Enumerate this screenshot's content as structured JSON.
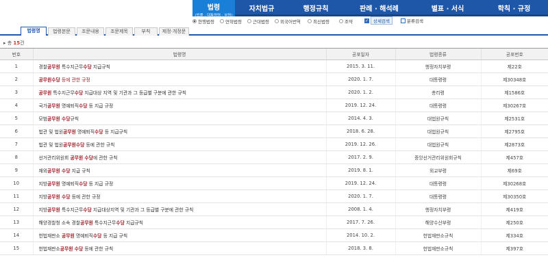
{
  "nav": {
    "items": [
      {
        "label": "법령",
        "sub": "(법률 · 대통령령 · 부령)",
        "active": true
      },
      {
        "label": "자치법규"
      },
      {
        "label": "행정규칙"
      },
      {
        "label": "판례 · 해석례"
      },
      {
        "label": "별표 · 서식"
      },
      {
        "label": "학칙 · 규정"
      }
    ]
  },
  "filters": {
    "radios": [
      "현행법령",
      "연혁법령",
      "근대법령",
      "외국어번역",
      "최신법령",
      "조약"
    ],
    "selected": "현행법령",
    "detail_search": "상세검색",
    "category_search": "분류검색"
  },
  "tabs": [
    "법령명",
    "법령본문",
    "조문내용",
    "조문제목",
    "부칙",
    "제정·개정문"
  ],
  "total": {
    "prefix": "▸ 총 ",
    "count": "15",
    "suffix": "건"
  },
  "table": {
    "headers": [
      "번호",
      "법령명",
      "공포일자",
      "법령종류",
      "공포번호"
    ],
    "rows": [
      {
        "no": "1",
        "name": [
          [
            "경찰",
            ""
          ],
          [
            "공무원",
            "hl"
          ],
          [
            " 특수지근무",
            ""
          ],
          [
            "수당",
            "hl"
          ],
          [
            " 지급규칙",
            ""
          ]
        ],
        "date": "2015. 3. 11.",
        "kind": "행정자치부령",
        "num": "제22호"
      },
      {
        "no": "2",
        "name": [
          [
            "공무원수당",
            "hl"
          ],
          [
            " 등에 관한 규정",
            "hl2"
          ]
        ],
        "date": "2020. 1. 7.",
        "kind": "대통령령",
        "num": "제30348호"
      },
      {
        "no": "3",
        "name": [
          [
            "공무원",
            "hl"
          ],
          [
            " 특수지근무",
            ""
          ],
          [
            "수당",
            "hl"
          ],
          [
            " 지급대상 지역 및 기관과 그 등급별 구분에 관한 규칙",
            ""
          ]
        ],
        "date": "2020. 1. 2.",
        "kind": "총리령",
        "num": "제1586호"
      },
      {
        "no": "4",
        "name": [
          [
            "국가",
            ""
          ],
          [
            "공무원",
            "hl"
          ],
          [
            " 명예퇴직",
            ""
          ],
          [
            "수당",
            "hl"
          ],
          [
            " 등 지급 규정",
            ""
          ]
        ],
        "date": "2019. 12. 24.",
        "kind": "대통령령",
        "num": "제30267호"
      },
      {
        "no": "5",
        "name": [
          [
            "모범",
            ""
          ],
          [
            "공무원",
            "hl"
          ],
          [
            " ",
            ""
          ],
          [
            "수당",
            "hl"
          ],
          [
            "규칙",
            ""
          ]
        ],
        "date": "2014. 4. 3.",
        "kind": "대법원규칙",
        "num": "제2531호"
      },
      {
        "no": "6",
        "name": [
          [
            "법관 및 법원",
            ""
          ],
          [
            "공무원",
            "hl"
          ],
          [
            " 명예퇴직",
            ""
          ],
          [
            "수당",
            "hl"
          ],
          [
            " 등 지급규칙",
            ""
          ]
        ],
        "date": "2018. 6. 28.",
        "kind": "대법원규칙",
        "num": "제2795호"
      },
      {
        "no": "7",
        "name": [
          [
            "법관 및 법원",
            ""
          ],
          [
            "공무원수당",
            "hl"
          ],
          [
            " 등에 관한 규칙",
            ""
          ]
        ],
        "date": "2019. 12. 26.",
        "kind": "대법원규칙",
        "num": "제2873호"
      },
      {
        "no": "8",
        "name": [
          [
            "선거관리위원회 ",
            ""
          ],
          [
            "공무원",
            "hl"
          ],
          [
            " ",
            ""
          ],
          [
            "수당",
            "hl"
          ],
          [
            "에 관한 규칙",
            ""
          ]
        ],
        "date": "2017. 2. 9.",
        "kind": "중앙선거관리위원회규칙",
        "num": "제457호"
      },
      {
        "no": "9",
        "name": [
          [
            "재외",
            ""
          ],
          [
            "공무원",
            "hl"
          ],
          [
            " ",
            ""
          ],
          [
            "수당",
            "hl"
          ],
          [
            " 지급 규칙",
            ""
          ]
        ],
        "date": "2019. 8. 1.",
        "kind": "외교부령",
        "num": "제69호"
      },
      {
        "no": "10",
        "name": [
          [
            "지방",
            ""
          ],
          [
            "공무원",
            "hl"
          ],
          [
            " 명예퇴직",
            ""
          ],
          [
            "수당",
            "hl"
          ],
          [
            " 등 지급 규정",
            ""
          ]
        ],
        "date": "2019. 12. 24.",
        "kind": "대통령령",
        "num": "제30268호"
      },
      {
        "no": "11",
        "name": [
          [
            "지방",
            ""
          ],
          [
            "공무원",
            "hl"
          ],
          [
            " ",
            ""
          ],
          [
            "수당",
            "hl"
          ],
          [
            " 등에 관한 규정",
            ""
          ]
        ],
        "date": "2020. 1. 7.",
        "kind": "대통령령",
        "num": "제30350호"
      },
      {
        "no": "12",
        "name": [
          [
            "지방",
            ""
          ],
          [
            "공무원",
            "hl"
          ],
          [
            " 특수지근무",
            ""
          ],
          [
            "수당",
            "hl"
          ],
          [
            " 지급대상지역 및 기관과 그 등급별 구분에 관한 규칙",
            ""
          ]
        ],
        "date": "2008. 1. 4.",
        "kind": "행정자치부령",
        "num": "제419호"
      },
      {
        "no": "13",
        "name": [
          [
            "해양경찰청 소속 경찰",
            ""
          ],
          [
            "공무원",
            "hl"
          ],
          [
            " 특수지근무",
            ""
          ],
          [
            "수당",
            "hl"
          ],
          [
            " 지급규칙",
            ""
          ]
        ],
        "date": "2017. 7. 26.",
        "kind": "해양수산부령",
        "num": "제250호"
      },
      {
        "no": "14",
        "name": [
          [
            "헌법재판소 ",
            ""
          ],
          [
            "공무원",
            "hl"
          ],
          [
            " 명예퇴직",
            ""
          ],
          [
            "수당",
            "hl"
          ],
          [
            " 등 지급 규칙",
            ""
          ]
        ],
        "date": "2014. 10. 2.",
        "kind": "헌법재판소규칙",
        "num": "제334호"
      },
      {
        "no": "15",
        "name": [
          [
            "헌법재판소",
            ""
          ],
          [
            "공무원",
            "hl"
          ],
          [
            " ",
            ""
          ],
          [
            "수당",
            "hl"
          ],
          [
            " 등에 관한 규칙",
            ""
          ]
        ],
        "date": "2018. 3. 8.",
        "kind": "헌법재판소규칙",
        "num": "제397호"
      }
    ]
  }
}
